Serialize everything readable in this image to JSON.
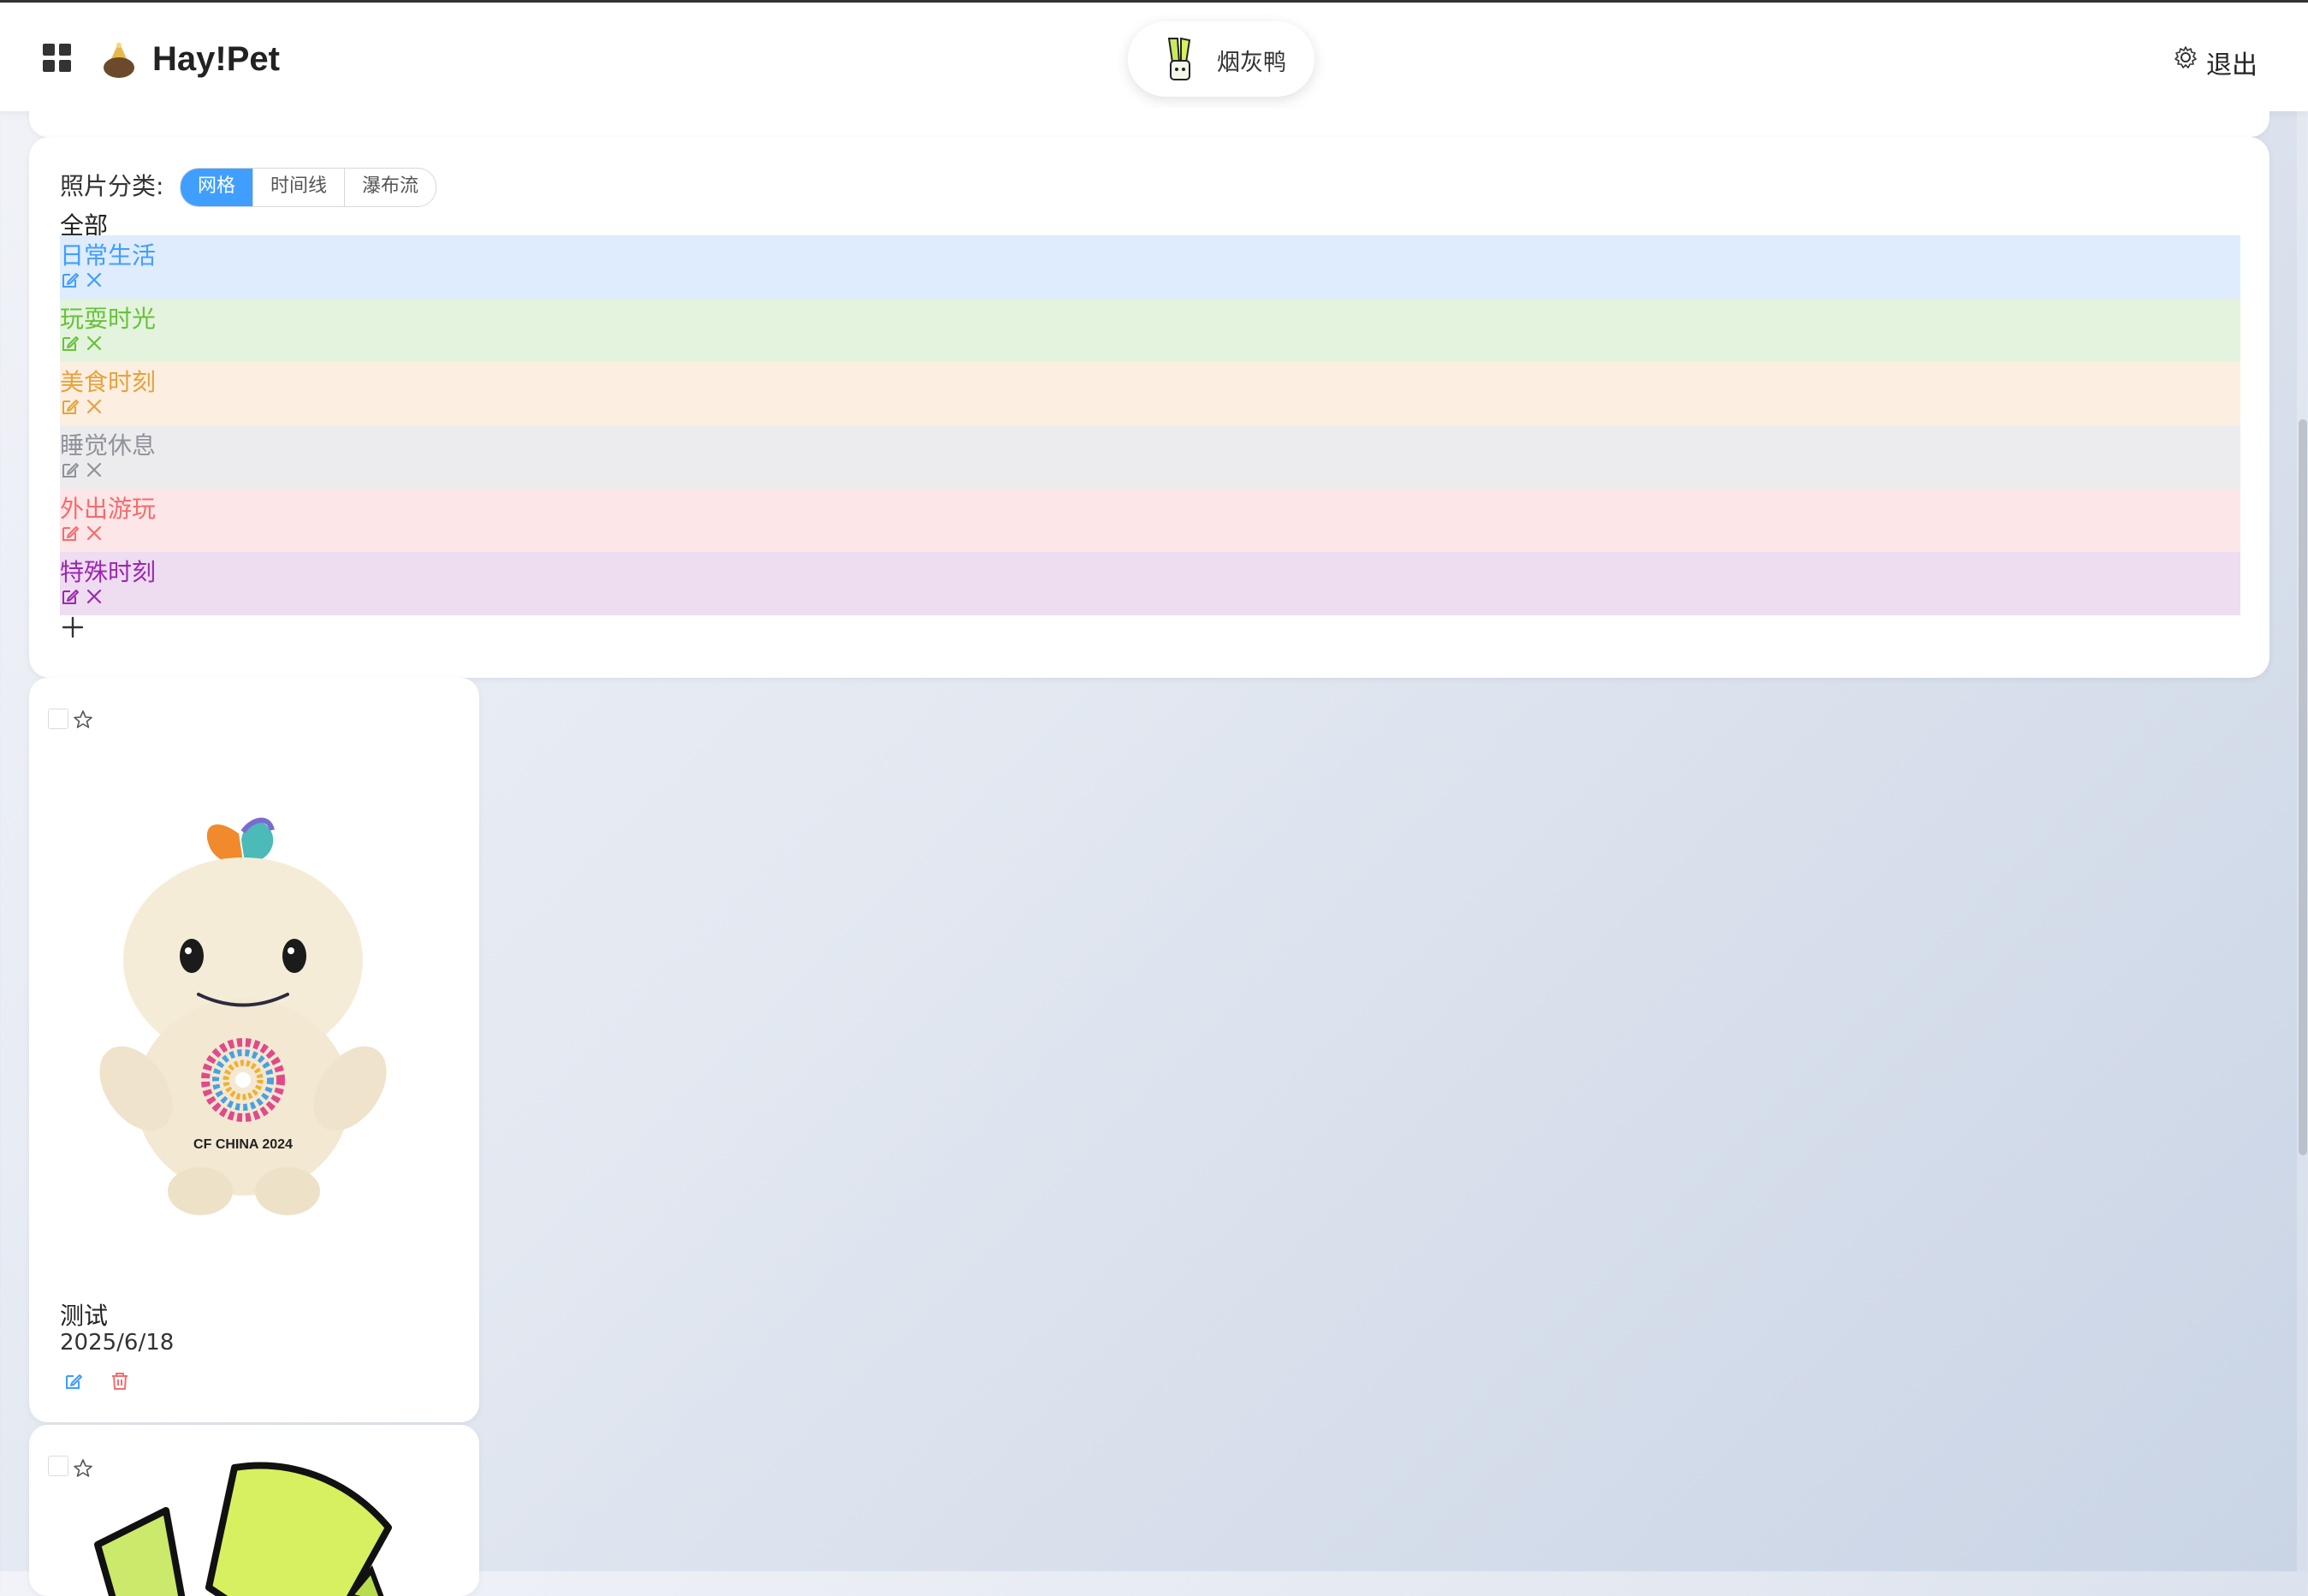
{
  "header": {
    "brand": "Hay!Pet",
    "user_name": "烟灰鸭",
    "logout_label": "退出"
  },
  "categories": {
    "label": "照片分类:",
    "view_modes": [
      "网格",
      "时间线",
      "瀑布流"
    ],
    "active_view": "网格",
    "all_label": "全部",
    "items": [
      {
        "name": "日常生活",
        "color": "#409eff",
        "bg": "#deecfd"
      },
      {
        "name": "玩耍时光",
        "color": "#67c23a",
        "bg": "#e4f3de"
      },
      {
        "name": "美食时刻",
        "color": "#e6a23c",
        "bg": "#fcefe1"
      },
      {
        "name": "睡觉休息",
        "color": "#909399",
        "bg": "#ececef"
      },
      {
        "name": "外出游玩",
        "color": "#f56c6c",
        "bg": "#fde6e8"
      },
      {
        "name": "特殊时刻",
        "color": "#9c27b0",
        "bg": "#eedcf1"
      }
    ]
  },
  "photos": [
    {
      "title": "测试",
      "date": "2025/6/18",
      "badge_text": "CF CHINA 2024"
    },
    {
      "title": "",
      "date": ""
    }
  ],
  "colors": {
    "accent": "#409eff",
    "danger": "#f56c6c"
  }
}
